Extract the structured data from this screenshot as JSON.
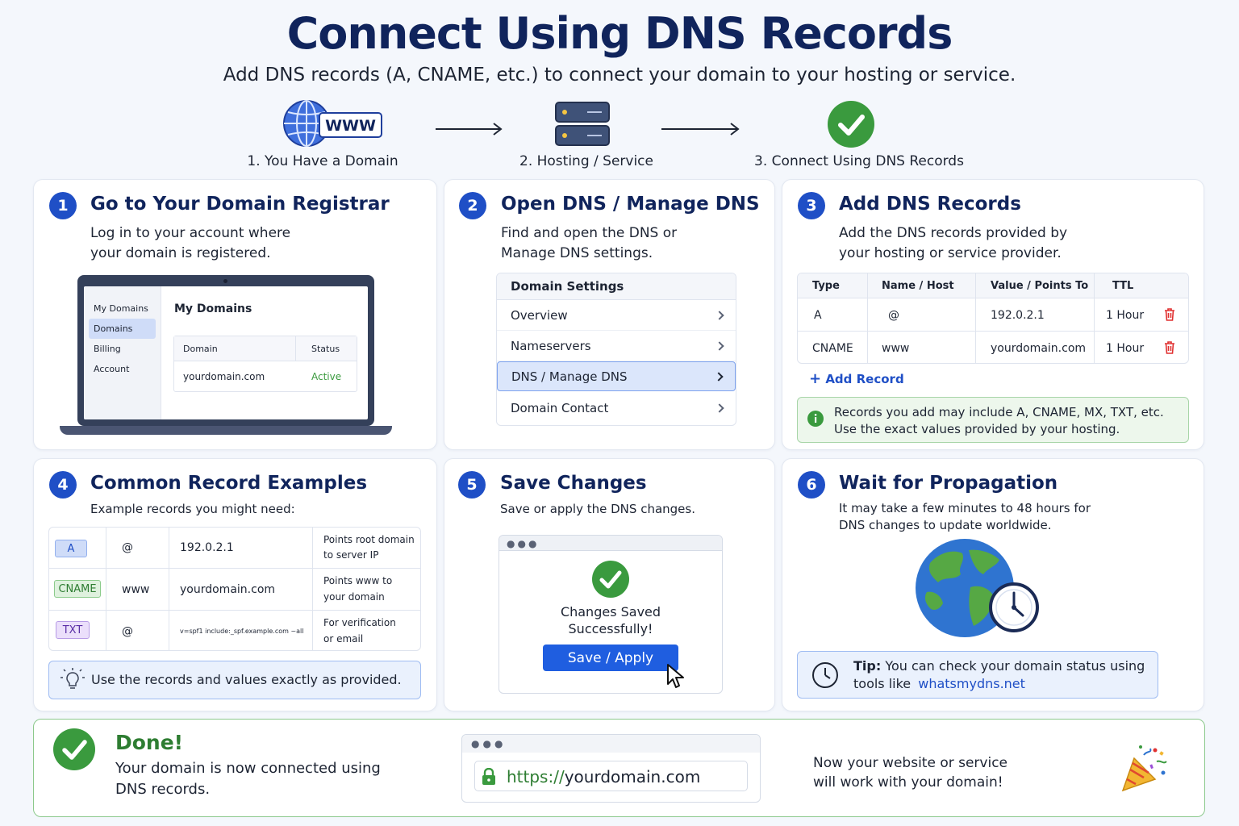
{
  "header": {
    "title": "Connect Using DNS Records",
    "subtitle": "Add DNS records (A, CNAME, etc.) to connect your domain to your hosting or service."
  },
  "flow": {
    "step1": {
      "label": "1. You Have a Domain",
      "badge": "WWW"
    },
    "step2": {
      "label": "2. Hosting / Service"
    },
    "step3": {
      "label": "3. Connect Using DNS Records"
    }
  },
  "card1": {
    "num": "1",
    "title": "Go to Your Domain Registrar",
    "desc1": "Log in to your account where",
    "desc2": "your domain is registered.",
    "laptop": {
      "sidebar": [
        "My Domains",
        "Domains",
        "Billing",
        "Account"
      ],
      "heading": "My Domains",
      "col_domain": "Domain",
      "col_status": "Status",
      "row_domain": "yourdomain.com",
      "row_status": "Active"
    }
  },
  "card2": {
    "num": "2",
    "title": "Open DNS / Manage DNS",
    "desc1": "Find and open the DNS or",
    "desc2": "Manage DNS settings.",
    "list_header": "Domain Settings",
    "items": [
      "Overview",
      "Nameservers",
      "DNS / Manage DNS",
      "Domain Contact"
    ]
  },
  "card3": {
    "num": "3",
    "title": "Add DNS Records",
    "desc1": "Add the DNS records provided by",
    "desc2": "your hosting or service provider.",
    "columns": [
      "Type",
      "Name / Host",
      "Value / Points To",
      "TTL"
    ],
    "rows": [
      {
        "type": "A",
        "name": "@",
        "value": "192.0.2.1",
        "ttl": "1 Hour"
      },
      {
        "type": "CNAME",
        "name": "www",
        "value": "yourdomain.com",
        "ttl": "1 Hour"
      }
    ],
    "add_record": "Add Record",
    "note1": "Records you add may include A, CNAME, MX, TXT, etc.",
    "note2": "Use the exact values provided by your hosting."
  },
  "card4": {
    "num": "4",
    "title": "Common Record Examples",
    "desc": "Example records you might need:",
    "rows": [
      {
        "type": "A",
        "name": "@",
        "value": "192.0.2.1",
        "note1": "Points root domain",
        "note2": "to server IP"
      },
      {
        "type": "CNAME",
        "name": "www",
        "value": "yourdomain.com",
        "note1": "Points www to",
        "note2": "your domain"
      },
      {
        "type": "TXT",
        "name": "@",
        "value": "v=spf1 include:_spf.example.com ~all",
        "note1": "For verification",
        "note2": "or email"
      }
    ],
    "tip": "Use the records and values exactly as provided."
  },
  "card5": {
    "num": "5",
    "title": "Save Changes",
    "desc": "Save or apply the DNS changes.",
    "saved1": "Changes Saved",
    "saved2": "Successfully!",
    "button": "Save / Apply"
  },
  "card6": {
    "num": "6",
    "title": "Wait for Propagation",
    "desc1": "It may take a few minutes to 48 hours for",
    "desc2": "DNS changes to update worldwide.",
    "tip_label": "Tip:",
    "tip_text": "You can check your domain status using",
    "tip_text2": "tools like",
    "tip_link": "whatsmydns.net"
  },
  "done": {
    "title": "Done!",
    "desc1": "Your domain is now connected using",
    "desc2": "DNS records.",
    "url_scheme": "https://",
    "url_host": "yourdomain.com",
    "right1": "Now your website or service",
    "right2": "will work with your domain!"
  },
  "colors": {
    "navy": "#10245c",
    "blue": "#1f4fc6",
    "green": "#3a9a3e",
    "red": "#e03131"
  }
}
